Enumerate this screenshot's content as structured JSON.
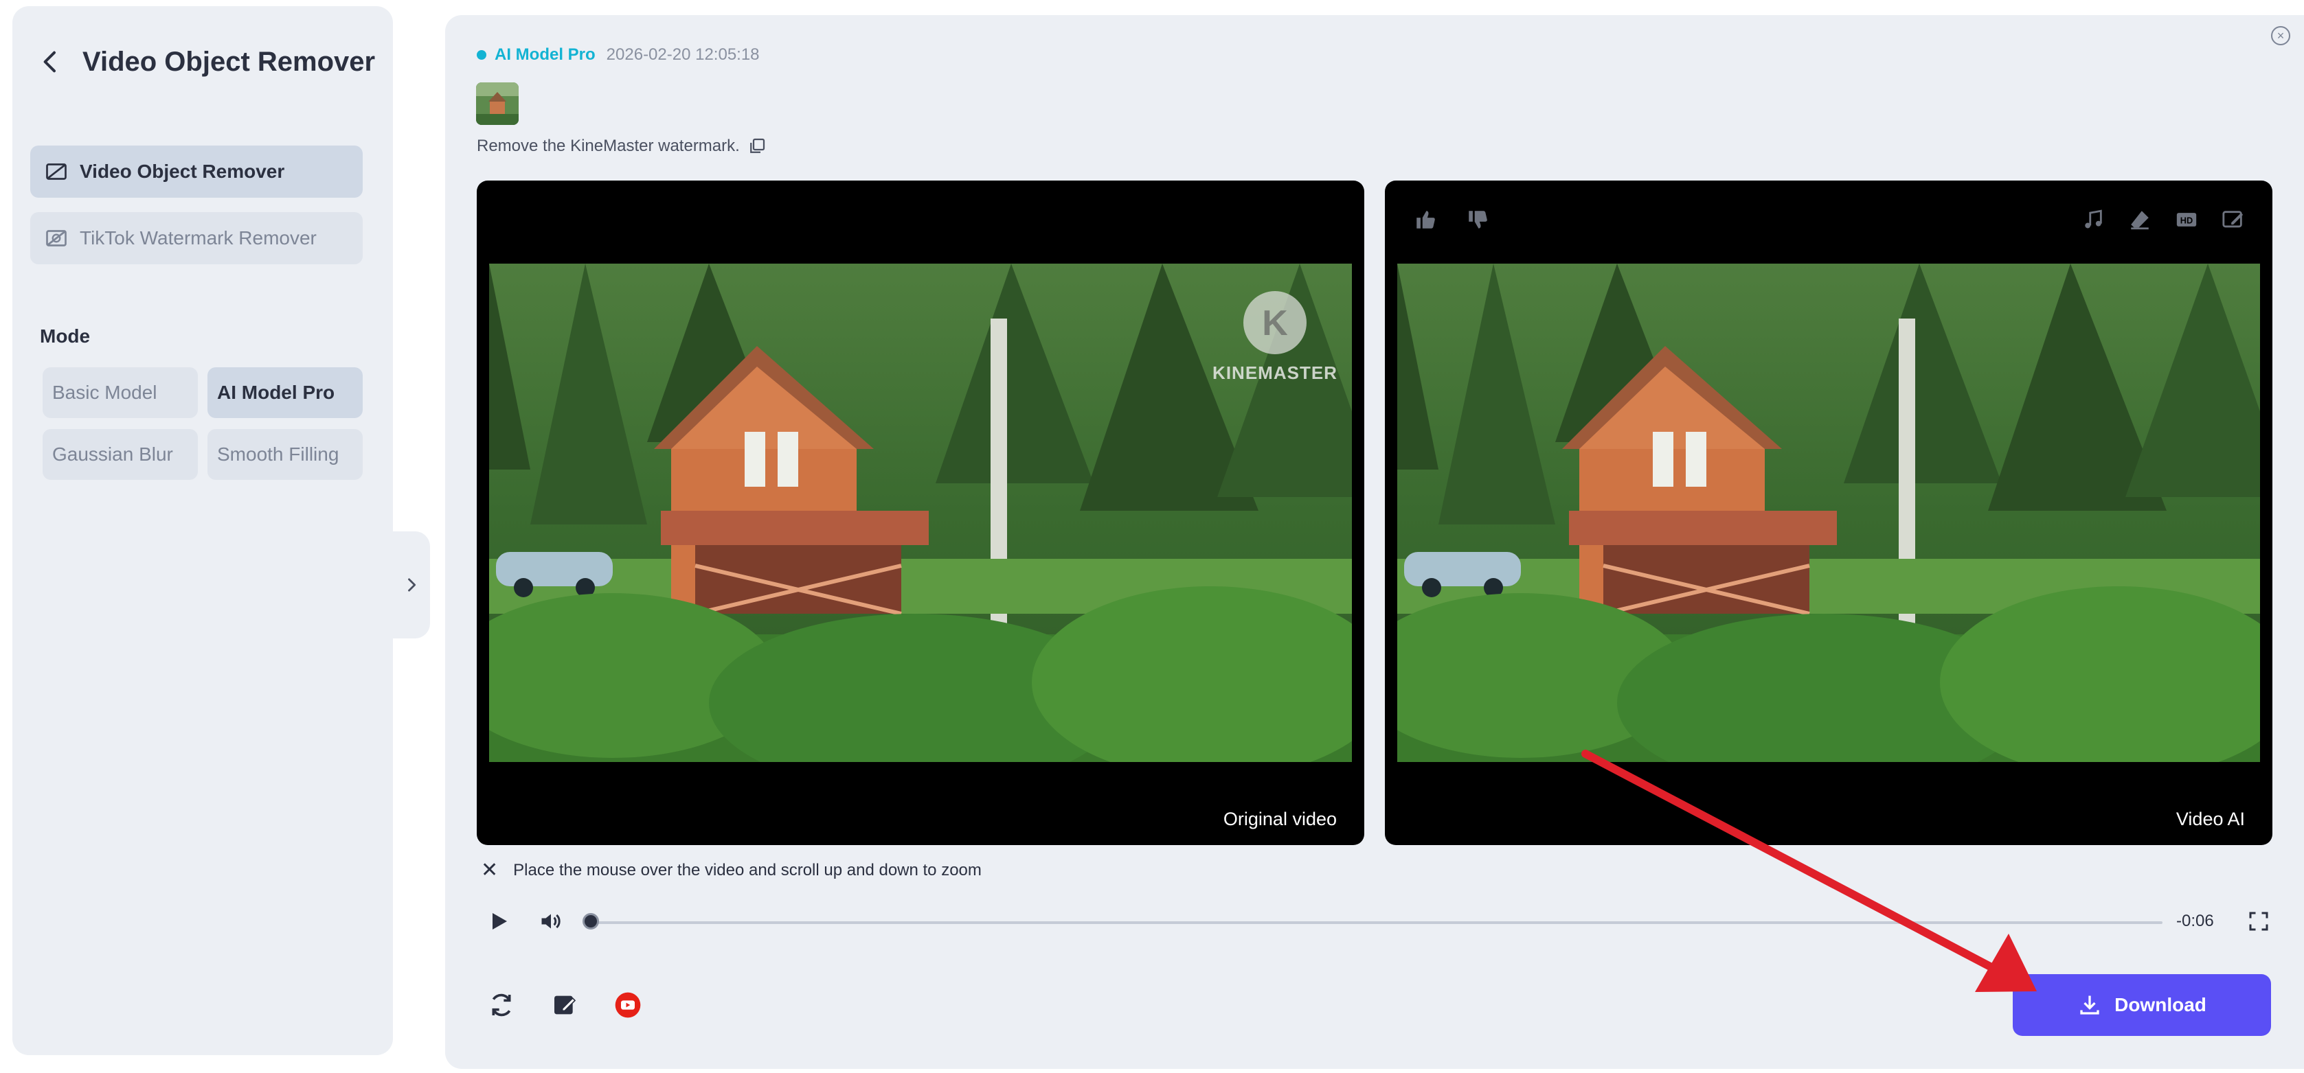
{
  "sidebar": {
    "title": "Video Object Remover",
    "tools": [
      {
        "label": "Video Object Remover",
        "active": true
      },
      {
        "label": "TikTok Watermark Remover",
        "active": false
      }
    ],
    "mode_label": "Mode",
    "modes": [
      {
        "label": "Basic Model",
        "active": false
      },
      {
        "label": "AI Model Pro",
        "active": true
      },
      {
        "label": "Gaussian Blur",
        "active": false
      },
      {
        "label": "Smooth Filling",
        "active": false
      }
    ]
  },
  "task": {
    "model": "AI Model Pro",
    "timestamp": "2026-02-20 12:05:18",
    "prompt": "Remove the KineMaster watermark."
  },
  "videos": {
    "original_label": "Original video",
    "result_label": "Video AI",
    "watermark_text": "KINEMASTER",
    "watermark_letter": "K"
  },
  "player": {
    "zoom_hint": "Place the mouse over the video and scroll up and down to zoom",
    "time_remaining": "-0:06",
    "progress": 0
  },
  "actions": {
    "download_label": "Download"
  },
  "colors": {
    "accent": "#13b3d3",
    "download": "#5a4ff5",
    "arrow": "#e0202a",
    "youtube": "#e62117"
  }
}
